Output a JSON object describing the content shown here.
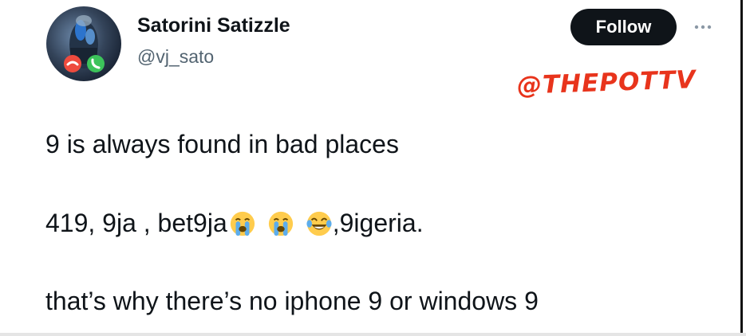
{
  "author": {
    "display_name": "Satorini Satizzle",
    "handle": "@vj_sato",
    "avatar_icon": "avatar-call-image"
  },
  "actions": {
    "follow_label": "Follow",
    "more_icon": "more-horizontal-icon"
  },
  "watermark": {
    "text": "@THEPOTTV",
    "color": "#e8341c"
  },
  "tweet": {
    "line1": "9 is always found in bad places",
    "line2_prefix": "419, 9ja , bet9ja",
    "line2_suffix": ",9igeria.",
    "line2_emojis": [
      "loudly-crying-face-icon",
      "loudly-crying-face-icon",
      "tears-of-joy-face-icon"
    ],
    "line3": "that’s  why there’s no iphone 9 or windows 9"
  },
  "colors": {
    "text": "#0f1419",
    "secondary": "#536471",
    "follow_bg": "#0f1419",
    "follow_text": "#ffffff"
  }
}
